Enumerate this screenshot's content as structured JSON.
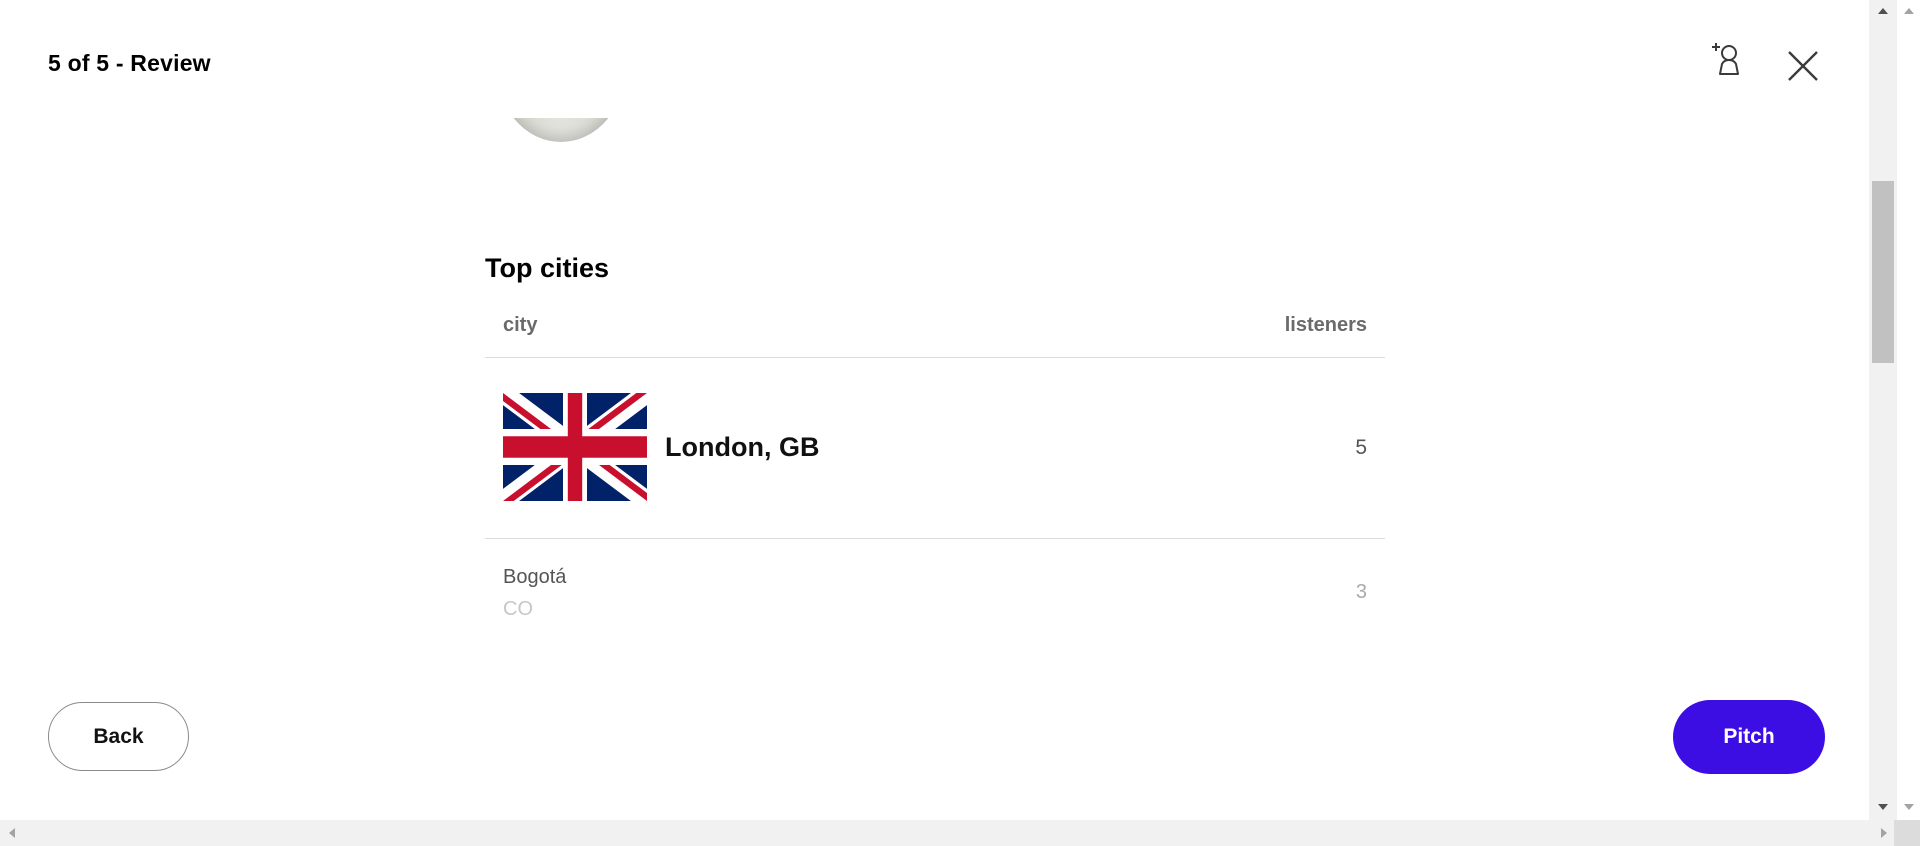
{
  "header": {
    "title": "5 of 5 - Review"
  },
  "icons": {
    "add_user": "add-user-icon",
    "close": "close-icon",
    "flag": "flag-gb-icon"
  },
  "top_cities": {
    "title": "Top cities",
    "columns": {
      "city": "city",
      "listeners": "listeners"
    },
    "rows": [
      {
        "city": "London, GB",
        "listeners": "5"
      },
      {
        "city": "Bogotá",
        "country": "CO",
        "listeners": "3"
      }
    ]
  },
  "footer": {
    "back_label": "Back",
    "pitch_label": "Pitch"
  },
  "colors": {
    "primary": "#3d0ee3",
    "flag_blue": "#012169",
    "flag_red": "#C8102E"
  }
}
